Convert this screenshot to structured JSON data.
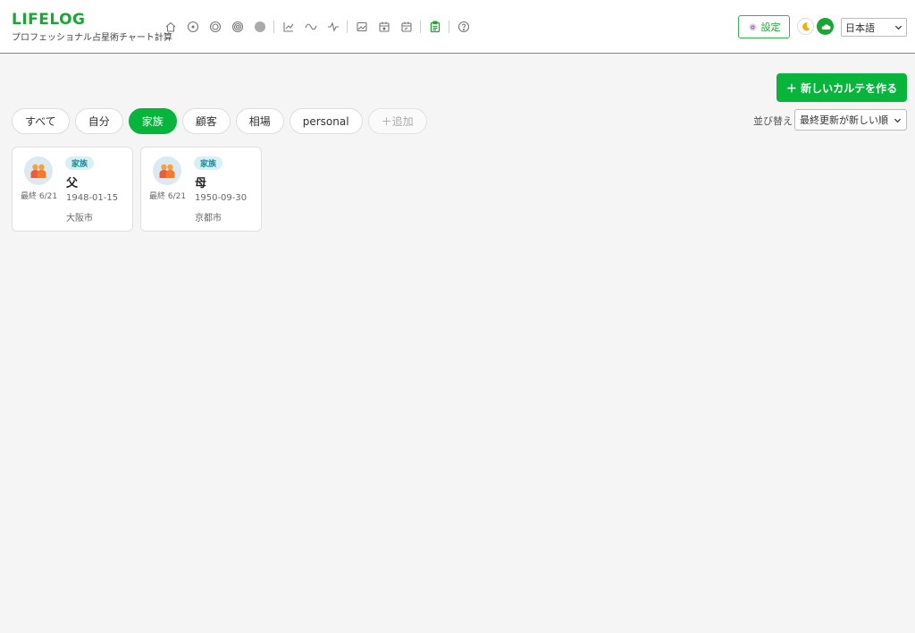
{
  "brand": {
    "title": "LIFELOG",
    "subtitle": "プロフェッショナル占星術チャート計算"
  },
  "nav": {
    "icons": [
      "home-icon",
      "circle-dot-icon",
      "double-circle-icon",
      "triple-circle-icon",
      "filled-circle-icon",
      "line-chart-icon",
      "wave-icon",
      "pulse-icon",
      "image-icon",
      "calendar-icon",
      "calendar-edit-icon",
      "clipboard-icon",
      "help-icon"
    ]
  },
  "header": {
    "settings_label": "設定",
    "language": "日本語"
  },
  "toolbar": {
    "new_button_label": "＋ 新しいカルテを作る",
    "sort_label": "並び替え",
    "sort_value": "最終更新が新しい順"
  },
  "tabs": [
    {
      "label": "すべて",
      "active": false
    },
    {
      "label": "自分",
      "active": false
    },
    {
      "label": "家族",
      "active": true
    },
    {
      "label": "顧客",
      "active": false
    },
    {
      "label": "相場",
      "active": false
    },
    {
      "label": "personal",
      "active": false
    },
    {
      "label": "＋追加",
      "active": false
    }
  ],
  "cards": [
    {
      "tag": "家族",
      "name": "父",
      "date": "1948-01-15",
      "place": "大阪市",
      "last_updated": "最終 6/21"
    },
    {
      "tag": "家族",
      "name": "母",
      "date": "1950-09-30",
      "place": "京都市",
      "last_updated": "最終 6/21"
    }
  ],
  "colors": {
    "accent": "#07b53b",
    "brand": "#17a832",
    "tag_bg": "#d8f0f3",
    "tag_text": "#1a8c98"
  }
}
